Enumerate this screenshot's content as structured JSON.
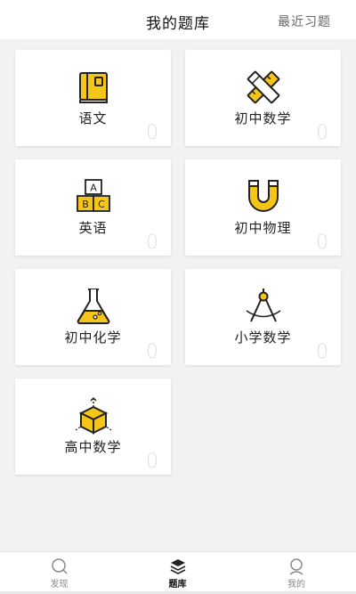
{
  "header": {
    "title": "我的题库",
    "recent_label": "最近习题"
  },
  "subjects": [
    {
      "label": "语文",
      "count": "0",
      "icon": "book-icon"
    },
    {
      "label": "初中数学",
      "count": "0",
      "icon": "ruler-pencil-icon"
    },
    {
      "label": "英语",
      "count": "0",
      "icon": "abc-blocks-icon"
    },
    {
      "label": "初中物理",
      "count": "0",
      "icon": "magnet-icon"
    },
    {
      "label": "初中化学",
      "count": "0",
      "icon": "flask-icon"
    },
    {
      "label": "小学数学",
      "count": "0",
      "icon": "compass-icon"
    },
    {
      "label": "高中数学",
      "count": "0",
      "icon": "cube-icon"
    }
  ],
  "tabs": [
    {
      "label": "发现",
      "icon": "discover-icon",
      "active": false
    },
    {
      "label": "题库",
      "icon": "layers-icon",
      "active": true
    },
    {
      "label": "我的",
      "icon": "profile-icon",
      "active": false
    }
  ],
  "colors": {
    "accent": "#f5c518",
    "outline": "#222222",
    "background": "#f2f2f2",
    "count": "#e0e0e0"
  }
}
